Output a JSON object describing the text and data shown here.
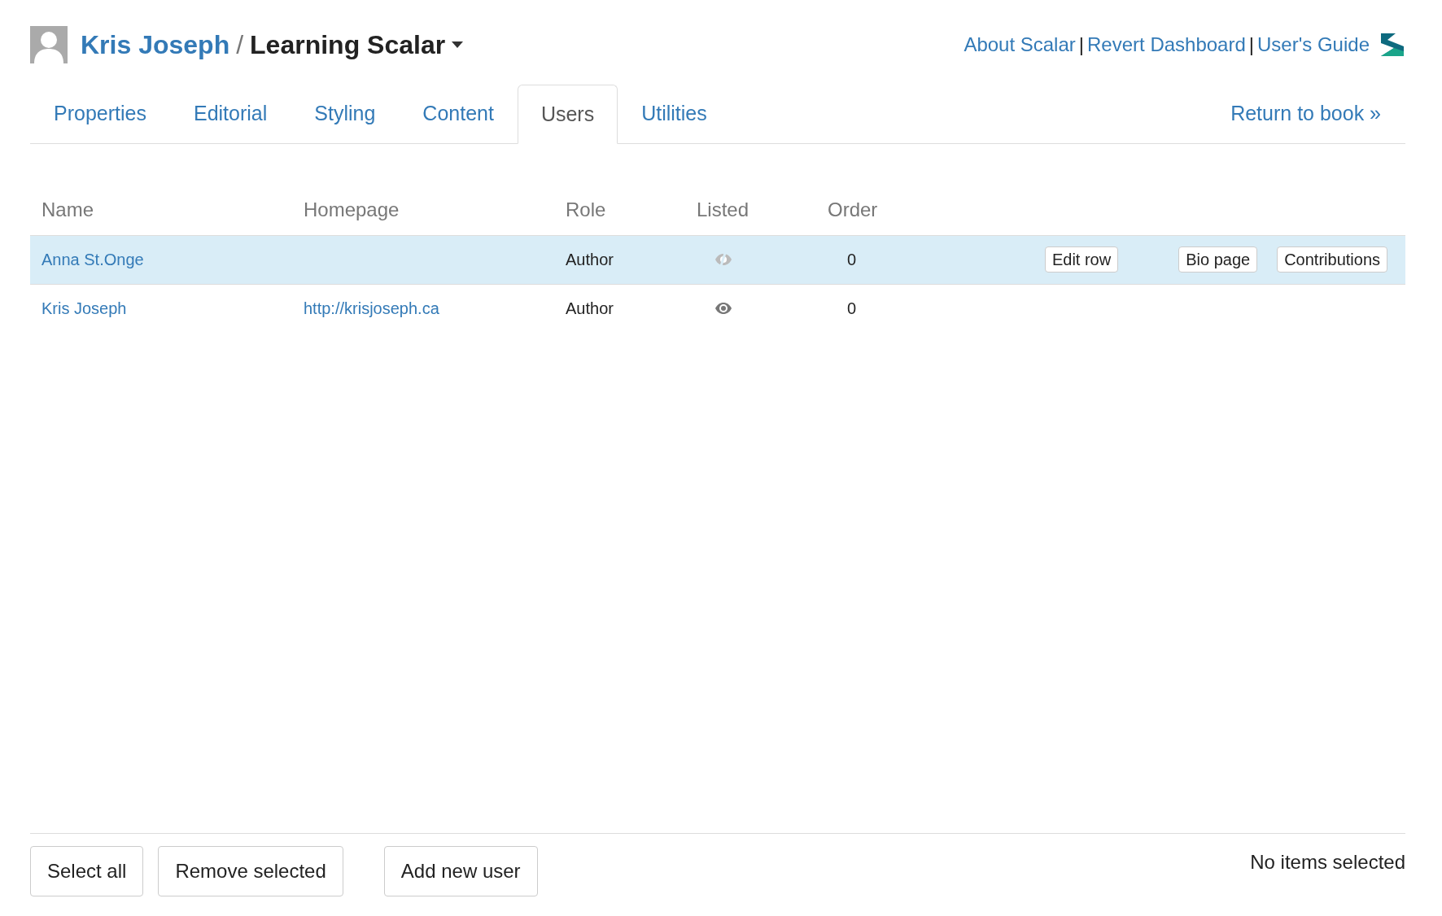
{
  "header": {
    "user": "Kris Joseph",
    "separator": "/",
    "book": "Learning Scalar",
    "links": [
      "About Scalar",
      "Revert Dashboard",
      "User's Guide"
    ],
    "link_separator": "|"
  },
  "tabs": [
    {
      "label": "Properties",
      "selected": false
    },
    {
      "label": "Editorial",
      "selected": false
    },
    {
      "label": "Styling",
      "selected": false
    },
    {
      "label": "Content",
      "selected": false
    },
    {
      "label": "Users",
      "selected": true
    },
    {
      "label": "Utilities",
      "selected": false
    }
  ],
  "return_link": "Return to book »",
  "table": {
    "columns": [
      "Name",
      "Homepage",
      "Role",
      "Listed",
      "Order"
    ],
    "rows": [
      {
        "name": "Anna St.Onge",
        "homepage": "",
        "role": "Author",
        "listed": false,
        "order": "0",
        "selected": true,
        "actions": [
          "Edit row",
          "Bio page",
          "Contributions"
        ]
      },
      {
        "name": "Kris Joseph",
        "homepage": "http://krisjoseph.ca",
        "role": "Author",
        "listed": true,
        "order": "0",
        "selected": false,
        "actions": []
      }
    ]
  },
  "footer": {
    "buttons": [
      "Select all",
      "Remove selected",
      "Add new user"
    ],
    "status": "No items selected"
  }
}
